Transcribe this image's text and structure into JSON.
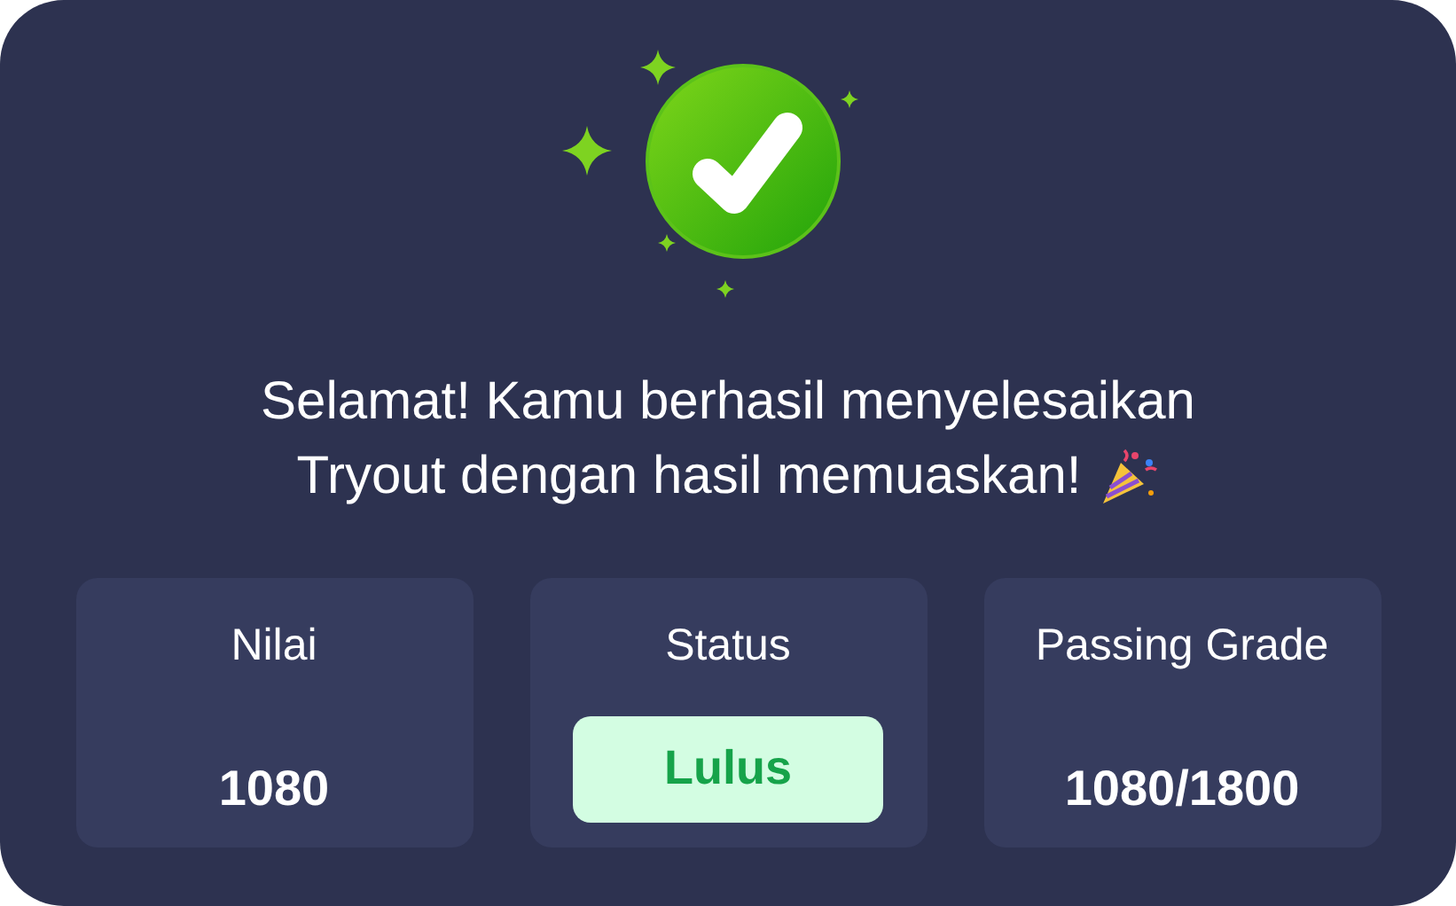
{
  "message": {
    "line_1": "Selamat! Kamu berhasil menyelesaikan",
    "line_2": "Tryout dengan hasil memuaskan!"
  },
  "stats": [
    {
      "kind": "value",
      "label": "Nilai",
      "value": "1080"
    },
    {
      "kind": "badge",
      "label": "Status",
      "value": "Lulus"
    },
    {
      "kind": "value",
      "label": "Passing Grade",
      "value": "1080/1800"
    }
  ]
}
